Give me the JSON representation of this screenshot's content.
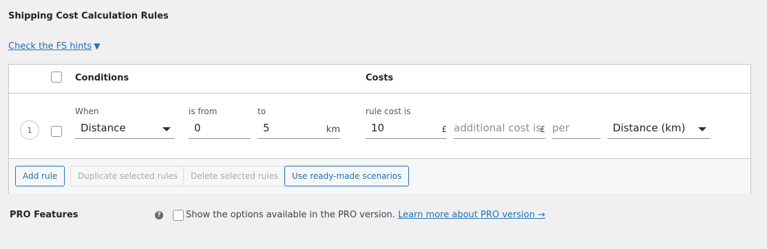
{
  "section": {
    "title": "Shipping Cost Calculation Rules",
    "hint_link": "Check the FS hints",
    "hint_arrow": "▼"
  },
  "table": {
    "headers": {
      "conditions": "Conditions",
      "costs": "Costs"
    },
    "rows": [
      {
        "index": "1",
        "when_label": "When",
        "when_value": "Distance",
        "is_from_label": "is from",
        "is_from_value": "0",
        "to_label": "to",
        "to_value": "5",
        "to_unit": "km",
        "rule_cost_label": "rule cost is",
        "rule_cost_value": "10",
        "currency": "£",
        "additional_cost_placeholder": "additional cost is",
        "additional_currency": "£",
        "per_placeholder": "per",
        "per_unit_value": "Distance (km)"
      }
    ],
    "buttons": {
      "add_rule": "Add rule",
      "duplicate": "Duplicate selected rules",
      "delete": "Delete selected rules",
      "scenarios": "Use ready-made scenarios"
    }
  },
  "pro": {
    "label": "PRO Features",
    "help_icon": "?",
    "checkbox_text": "Show the options available in the PRO version.",
    "learn_more": "Learn more about PRO version →"
  },
  "colors": {
    "link": "#2271b1",
    "border": "#c3c4c7",
    "background": "#f0f0f1"
  },
  "icons": {
    "help": "question-circle-icon",
    "dropdown": "chevron-down-icon"
  }
}
